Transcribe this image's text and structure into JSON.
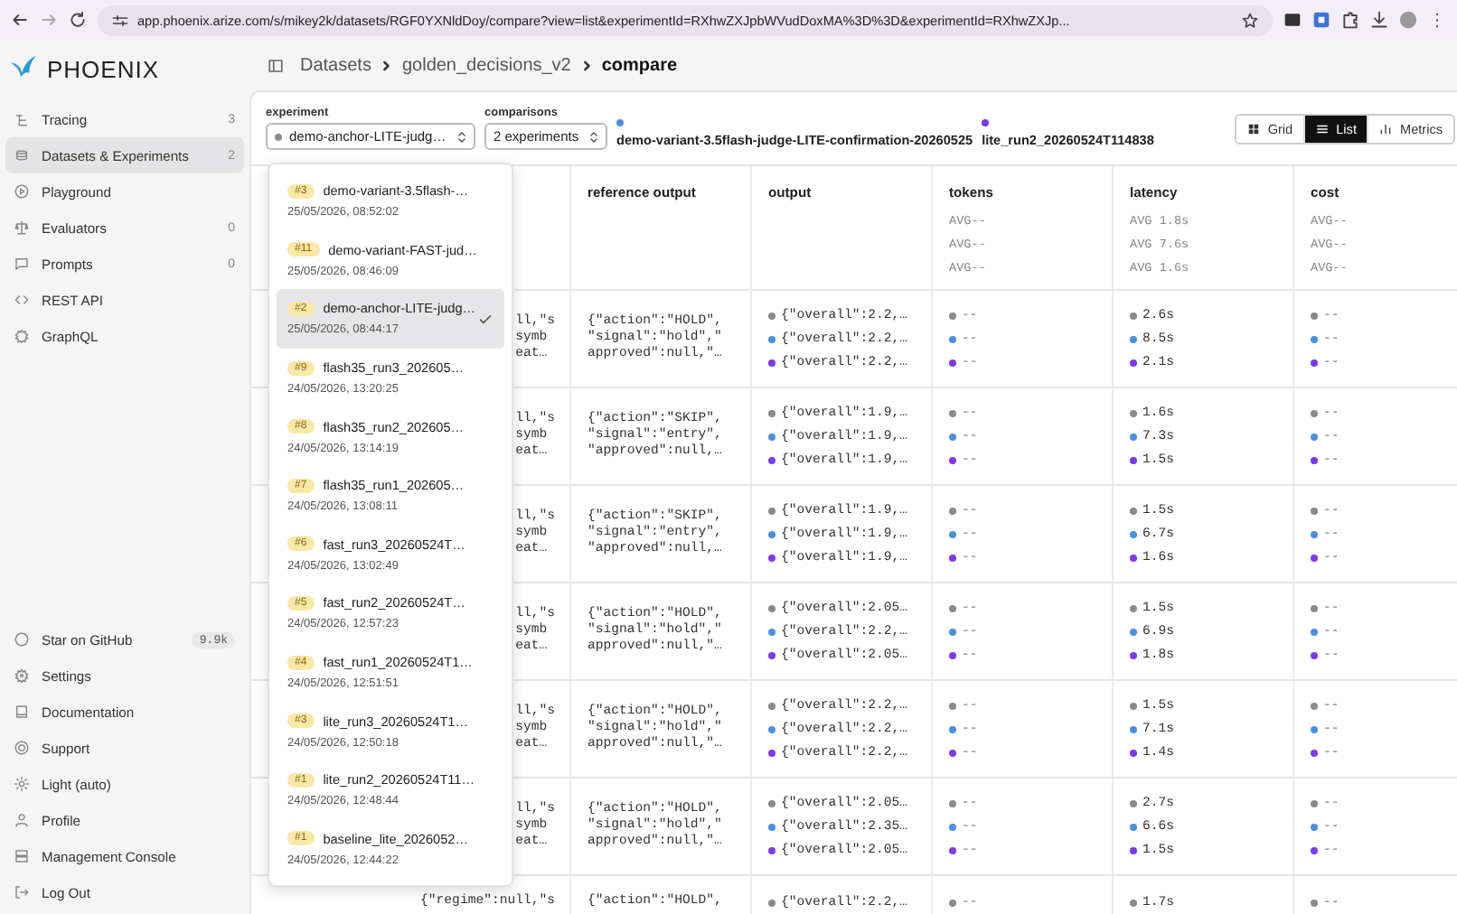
{
  "browser": {
    "url": "app.phoenix.arize.com/s/mikey2k/datasets/RGF0YXNldDoy/compare?view=list&experimentId=RXhwZXJpbWVudDoxMA%3D%3D&experimentId=RXhwZXJp..."
  },
  "sidebar": {
    "brand": "PHOENIX",
    "items": [
      {
        "label": "Tracing",
        "count": "3",
        "selected": false
      },
      {
        "label": "Datasets & Experiments",
        "count": "2",
        "selected": true
      },
      {
        "label": "Playground",
        "selected": false
      },
      {
        "label": "Evaluators",
        "count": "0",
        "selected": false
      },
      {
        "label": "Prompts",
        "count": "0",
        "selected": false
      },
      {
        "label": "REST API",
        "selected": false
      },
      {
        "label": "GraphQL",
        "selected": false
      }
    ],
    "footer_items": [
      {
        "label": "Star on GitHub",
        "badge": "9.9k"
      },
      {
        "label": "Settings"
      },
      {
        "label": "Documentation"
      },
      {
        "label": "Support"
      },
      {
        "label": "Light (auto)"
      },
      {
        "label": "Profile"
      },
      {
        "label": "Management Console"
      },
      {
        "label": "Log Out"
      }
    ]
  },
  "breadcrumb": [
    "Datasets",
    "golden_decisions_v2",
    "compare"
  ],
  "toolbar": {
    "experiment_label": "experiment",
    "experiment": {
      "value": "demo-anchor-LITE-judg…",
      "color": "#8a8a8a"
    },
    "comparisons_label": "comparisons",
    "comparisons_value": "2 experiments",
    "compared": [
      {
        "name": "demo-variant-3.5flash-judge-LITE-confirmation-20260525",
        "color": "#4a90e2"
      },
      {
        "name": "lite_run2_20260524T114838",
        "color": "#7c3aed"
      }
    ],
    "views": [
      {
        "label": "Grid",
        "selected": false
      },
      {
        "label": "List",
        "selected": true
      },
      {
        "label": "Metrics",
        "selected": false
      }
    ]
  },
  "dropdown": {
    "options": [
      {
        "badge": "#3",
        "name": "demo-variant-3.5flash-…",
        "date": "25/05/2026, 08:52:02",
        "selected": false
      },
      {
        "badge": "#11",
        "name": "demo-variant-FAST-jud…",
        "date": "25/05/2026, 08:46:09",
        "selected": false
      },
      {
        "badge": "#2",
        "name": "demo-anchor-LITE-judg…",
        "date": "25/05/2026, 08:44:17",
        "selected": true
      },
      {
        "badge": "#9",
        "name": "flash35_run3_202605…",
        "date": "24/05/2026, 13:20:25",
        "selected": false
      },
      {
        "badge": "#8",
        "name": "flash35_run2_202605…",
        "date": "24/05/2026, 13:14:19",
        "selected": false
      },
      {
        "badge": "#7",
        "name": "flash35_run1_202605…",
        "date": "24/05/2026, 13:08:11",
        "selected": false
      },
      {
        "badge": "#6",
        "name": "fast_run3_20260524T…",
        "date": "24/05/2026, 13:02:49",
        "selected": false
      },
      {
        "badge": "#5",
        "name": "fast_run2_20260524T…",
        "date": "24/05/2026, 12:57:23",
        "selected": false
      },
      {
        "badge": "#4",
        "name": "fast_run1_20260524T1…",
        "date": "24/05/2026, 12:51:51",
        "selected": false
      },
      {
        "badge": "#3",
        "name": "lite_run3_20260524T1…",
        "date": "24/05/2026, 12:50:18",
        "selected": false
      },
      {
        "badge": "#1",
        "name": "lite_run2_20260524T11…",
        "date": "24/05/2026, 12:48:44",
        "selected": false
      },
      {
        "badge": "#1",
        "name": "baseline_lite_2026052…",
        "date": "24/05/2026, 12:44:22",
        "selected": false
      }
    ]
  },
  "table": {
    "columns": [
      {
        "label": "reference output"
      },
      {
        "label": "output"
      },
      {
        "label": "tokens",
        "averages": [
          "AVG--",
          "AVG--",
          "AVG--"
        ]
      },
      {
        "label": "latency",
        "averages": [
          "AVG 1.8s",
          "AVG 7.6s",
          "AVG 1.6s"
        ]
      },
      {
        "label": "cost",
        "averages": [
          "AVG--",
          "AVG--",
          "AVG--"
        ]
      }
    ],
    "rows": [
      {
        "input": [
          "ll,\"s",
          "symb",
          "eat…"
        ],
        "reference": [
          "{\"action\":\"HOLD\",",
          "\"signal\":\"hold\",\"",
          "approved\":null,\"…"
        ],
        "output": [
          "{\"overall\":2.2,…",
          "{\"overall\":2.2,…",
          "{\"overall\":2.2,…"
        ],
        "tokens": [
          "--",
          "--",
          "--"
        ],
        "latency": [
          "2.6s",
          "8.5s",
          "2.1s"
        ],
        "cost": [
          "--",
          "--",
          "--"
        ]
      },
      {
        "input": [
          "ll,\"s",
          "symb",
          "eat…"
        ],
        "reference": [
          "{\"action\":\"SKIP\",",
          "\"signal\":\"entry\",",
          "\"approved\":null,…"
        ],
        "output": [
          "{\"overall\":1.9,…",
          "{\"overall\":1.9,…",
          "{\"overall\":1.9,…"
        ],
        "tokens": [
          "--",
          "--",
          "--"
        ],
        "latency": [
          "1.6s",
          "7.3s",
          "1.5s"
        ],
        "cost": [
          "--",
          "--",
          "--"
        ]
      },
      {
        "input": [
          "ll,\"s",
          "symb",
          "eat…"
        ],
        "reference": [
          "{\"action\":\"SKIP\",",
          "\"signal\":\"entry\",",
          "\"approved\":null,…"
        ],
        "output": [
          "{\"overall\":1.9,…",
          "{\"overall\":1.9,…",
          "{\"overall\":1.9,…"
        ],
        "tokens": [
          "--",
          "--",
          "--"
        ],
        "latency": [
          "1.5s",
          "6.7s",
          "1.6s"
        ],
        "cost": [
          "--",
          "--",
          "--"
        ]
      },
      {
        "input": [
          "ll,\"s",
          "symb",
          "eat…"
        ],
        "reference": [
          "{\"action\":\"HOLD\",",
          "\"signal\":\"hold\",\"",
          "approved\":null,\"…"
        ],
        "output": [
          "{\"overall\":2.05…",
          "{\"overall\":2.2,…",
          "{\"overall\":2.05…"
        ],
        "tokens": [
          "--",
          "--",
          "--"
        ],
        "latency": [
          "1.5s",
          "6.9s",
          "1.8s"
        ],
        "cost": [
          "--",
          "--",
          "--"
        ]
      },
      {
        "input": [
          "ll,\"s",
          "symb",
          "eat…"
        ],
        "reference": [
          "{\"action\":\"HOLD\",",
          "\"signal\":\"hold\",\"",
          "approved\":null,\"…"
        ],
        "output": [
          "{\"overall\":2.2,…",
          "{\"overall\":2.2,…",
          "{\"overall\":2.2,…"
        ],
        "tokens": [
          "--",
          "--",
          "--"
        ],
        "latency": [
          "1.5s",
          "7.1s",
          "1.4s"
        ],
        "cost": [
          "--",
          "--",
          "--"
        ]
      },
      {
        "input": [
          "ll,\"s",
          "symb",
          "eat…"
        ],
        "reference": [
          "{\"action\":\"HOLD\",",
          "\"signal\":\"hold\",\"",
          "approved\":null,\"…"
        ],
        "output": [
          "{\"overall\":2.05…",
          "{\"overall\":2.35…",
          "{\"overall\":2.05…"
        ],
        "tokens": [
          "--",
          "--",
          "--"
        ],
        "latency": [
          "2.7s",
          "6.6s",
          "1.5s"
        ],
        "cost": [
          "--",
          "--",
          "--"
        ]
      },
      {
        "input": [
          "{\"regime\":null,\"s"
        ],
        "reference": [
          "{\"action\":\"HOLD\","
        ],
        "output": [
          "{\"overall\":2.2,…"
        ],
        "tokens": [
          "--"
        ],
        "latency": [
          "1.7s"
        ],
        "cost": [
          "--"
        ]
      }
    ]
  }
}
